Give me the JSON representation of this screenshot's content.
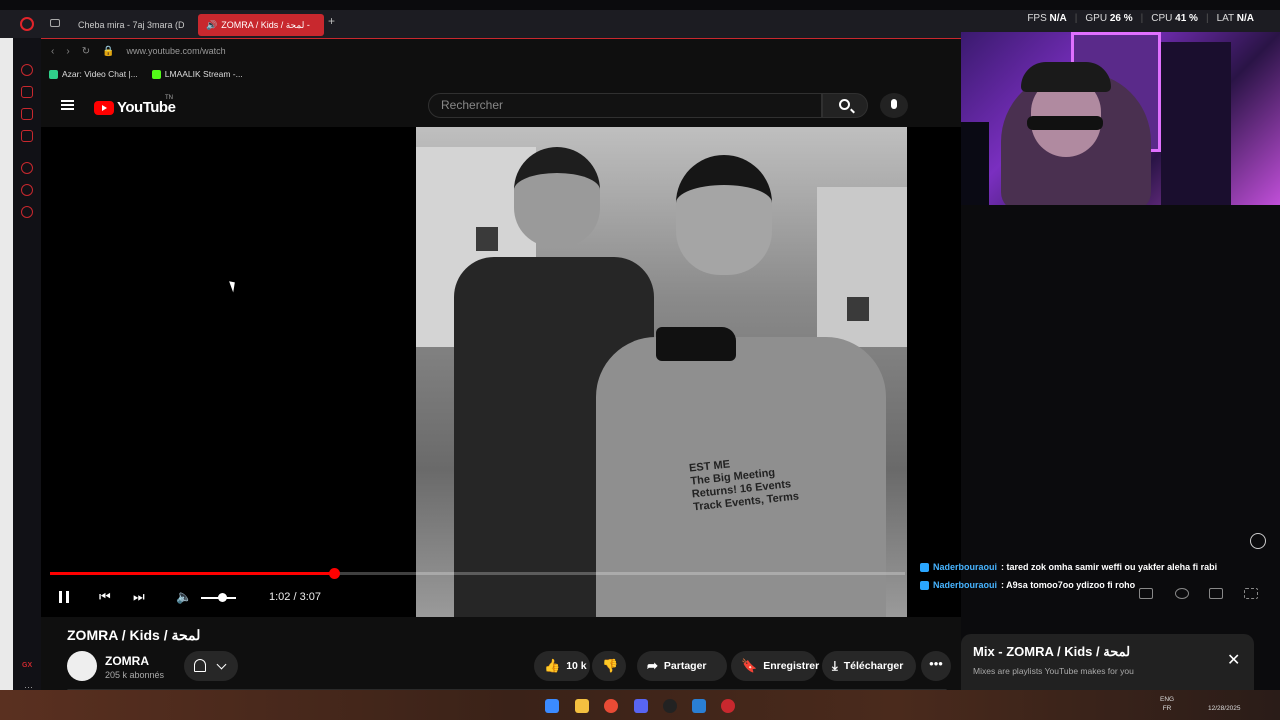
{
  "tabs": [
    {
      "label": "Cheba mira - 7aj 3mara (D"
    },
    {
      "label": "ZOMRA / Kids / لمحة -"
    }
  ],
  "new_tab_symbol": "+",
  "stats": {
    "fps_label": "FPS",
    "fps_value": "N/A",
    "gpu_label": "GPU",
    "gpu_value": "26 %",
    "cpu_label": "CPU",
    "cpu_value": "41 %",
    "lat_label": "LAT",
    "lat_value": "N/A"
  },
  "address": {
    "url": "www.youtube.com/watch"
  },
  "bookmarks": [
    {
      "label": "Azar: Video Chat |..."
    },
    {
      "label": "LMAALIK Stream -..."
    }
  ],
  "youtube": {
    "logo_text": "YouTube",
    "logo_tm": "TN",
    "search_placeholder": "Rechercher"
  },
  "player": {
    "time": "1:02 / 3:07",
    "progress_fraction": 0.332,
    "volume_fraction": 0.6,
    "shirt_text": "EST ME\nThe Big Meeting\nReturns! 16 Events\nTrack Events, Terms"
  },
  "video_info": {
    "title": "ZOMRA / Kids / لمحة",
    "channel_name": "ZOMRA",
    "subscribers": "205 k abonnés",
    "like_count": "10 k",
    "share_label": "Partager",
    "save_label": "Enregistrer",
    "download_label": "Télécharger",
    "more_symbol": "•••"
  },
  "chat": [
    {
      "user": "Naderbouraoui",
      "text": ": tared zok omha samir weffi ou yakfer aleha fi rabi"
    },
    {
      "user": "Naderbouraoui",
      "text": ": A9sa tomoo7oo ydizoo fi roho"
    }
  ],
  "mix": {
    "title": "Mix - ZOMRA / Kids / لمحة",
    "subtitle": "Mixes are playlists YouTube makes for you",
    "close_symbol": "✕"
  },
  "taskbar": {
    "lang_top": "ENG",
    "lang_bottom": "FR",
    "date": "12/28/2025"
  },
  "sidebar": {
    "gx_label": "GX"
  },
  "colors": {
    "accent": "#c8282e",
    "youtube_red": "#ff0000",
    "chat_user": "#47b4ff"
  }
}
